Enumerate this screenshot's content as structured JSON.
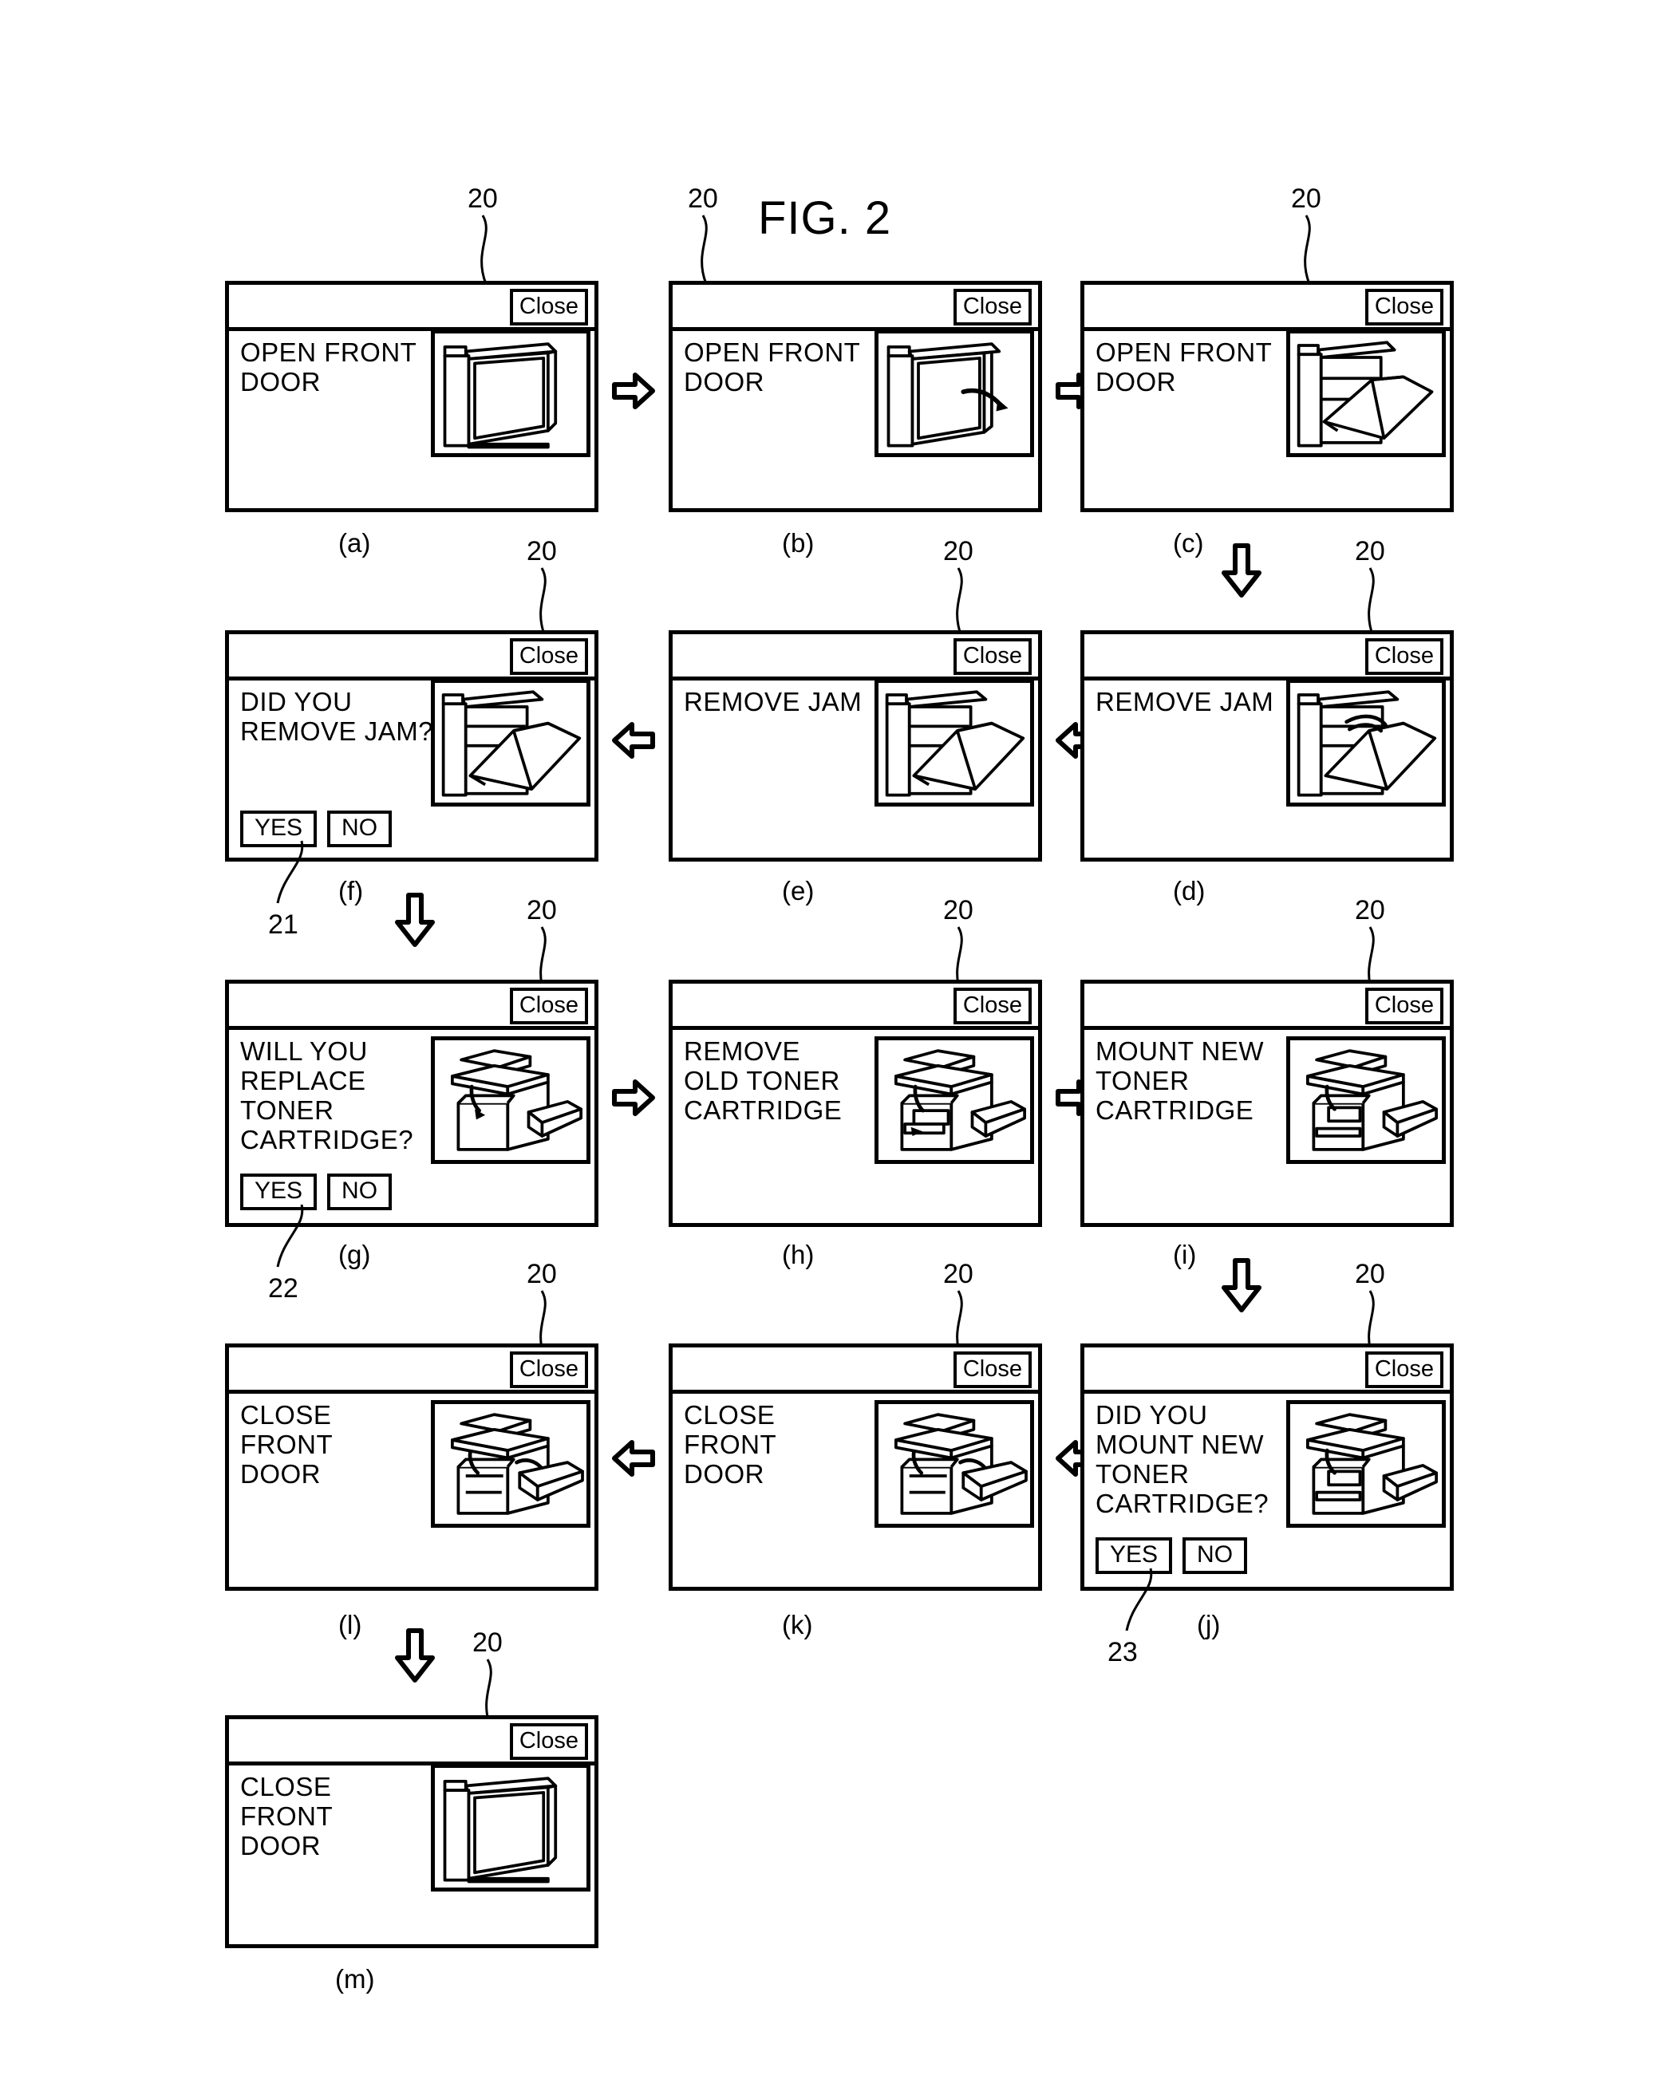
{
  "figure": {
    "title": "FIG. 2",
    "ref_panel": "20",
    "ref_yesno_f": "21",
    "ref_yesno_g": "22",
    "ref_yesno_j": "23"
  },
  "common": {
    "close_label": "Close",
    "yes_label": "YES",
    "no_label": "NO"
  },
  "panels": [
    {
      "id": "a",
      "caption": "(a)",
      "message": "OPEN FRONT\nDOOR",
      "illustration": "printer-front-door-closed",
      "has_yesno": false
    },
    {
      "id": "b",
      "caption": "(b)",
      "message": "OPEN FRONT\nDOOR",
      "illustration": "printer-front-door-hand",
      "has_yesno": false
    },
    {
      "id": "c",
      "caption": "(c)",
      "message": "OPEN FRONT\nDOOR",
      "illustration": "printer-front-door-open",
      "has_yesno": false
    },
    {
      "id": "d",
      "caption": "(d)",
      "message": "REMOVE JAM",
      "illustration": "printer-jam-hand",
      "has_yesno": false
    },
    {
      "id": "e",
      "caption": "(e)",
      "message": "REMOVE JAM",
      "illustration": "printer-jam",
      "has_yesno": false
    },
    {
      "id": "f",
      "caption": "(f)",
      "message": "DID YOU\nREMOVE JAM?",
      "illustration": "printer-jam",
      "has_yesno": true
    },
    {
      "id": "g",
      "caption": "(g)",
      "message": "WILL YOU\nREPLACE\nTONER\nCARTRIDGE?",
      "illustration": "printer-toner",
      "has_yesno": true
    },
    {
      "id": "h",
      "caption": "(h)",
      "message": "REMOVE\nOLD TONER\nCARTRIDGE",
      "illustration": "printer-toner-remove",
      "has_yesno": false
    },
    {
      "id": "i",
      "caption": "(i)",
      "message": "MOUNT NEW\nTONER\nCARTRIDGE",
      "illustration": "printer-toner-mount",
      "has_yesno": false
    },
    {
      "id": "j",
      "caption": "(j)",
      "message": "DID YOU\nMOUNT NEW\nTONER\nCARTRIDGE?",
      "illustration": "printer-toner-mount",
      "has_yesno": true
    },
    {
      "id": "k",
      "caption": "(k)",
      "message": "CLOSE\nFRONT\nDOOR",
      "illustration": "printer-toner-closing",
      "has_yesno": false
    },
    {
      "id": "l",
      "caption": "(l)",
      "message": "CLOSE\nFRONT\nDOOR",
      "illustration": "printer-toner-closing",
      "has_yesno": false
    },
    {
      "id": "m",
      "caption": "(m)",
      "message": "CLOSE\nFRONT\nDOOR",
      "illustration": "printer-front-door-closed",
      "has_yesno": false
    }
  ],
  "flow_arrows": [
    {
      "name": "arrow-a-to-b",
      "direction": "right"
    },
    {
      "name": "arrow-b-to-c",
      "direction": "right"
    },
    {
      "name": "arrow-c-to-d",
      "direction": "down"
    },
    {
      "name": "arrow-d-to-e",
      "direction": "left"
    },
    {
      "name": "arrow-e-to-f",
      "direction": "left"
    },
    {
      "name": "arrow-f-to-g",
      "direction": "down"
    },
    {
      "name": "arrow-g-to-h",
      "direction": "right"
    },
    {
      "name": "arrow-h-to-i",
      "direction": "right"
    },
    {
      "name": "arrow-i-to-j",
      "direction": "down"
    },
    {
      "name": "arrow-j-to-k",
      "direction": "left"
    },
    {
      "name": "arrow-k-to-l",
      "direction": "left"
    },
    {
      "name": "arrow-l-to-m",
      "direction": "down"
    }
  ]
}
